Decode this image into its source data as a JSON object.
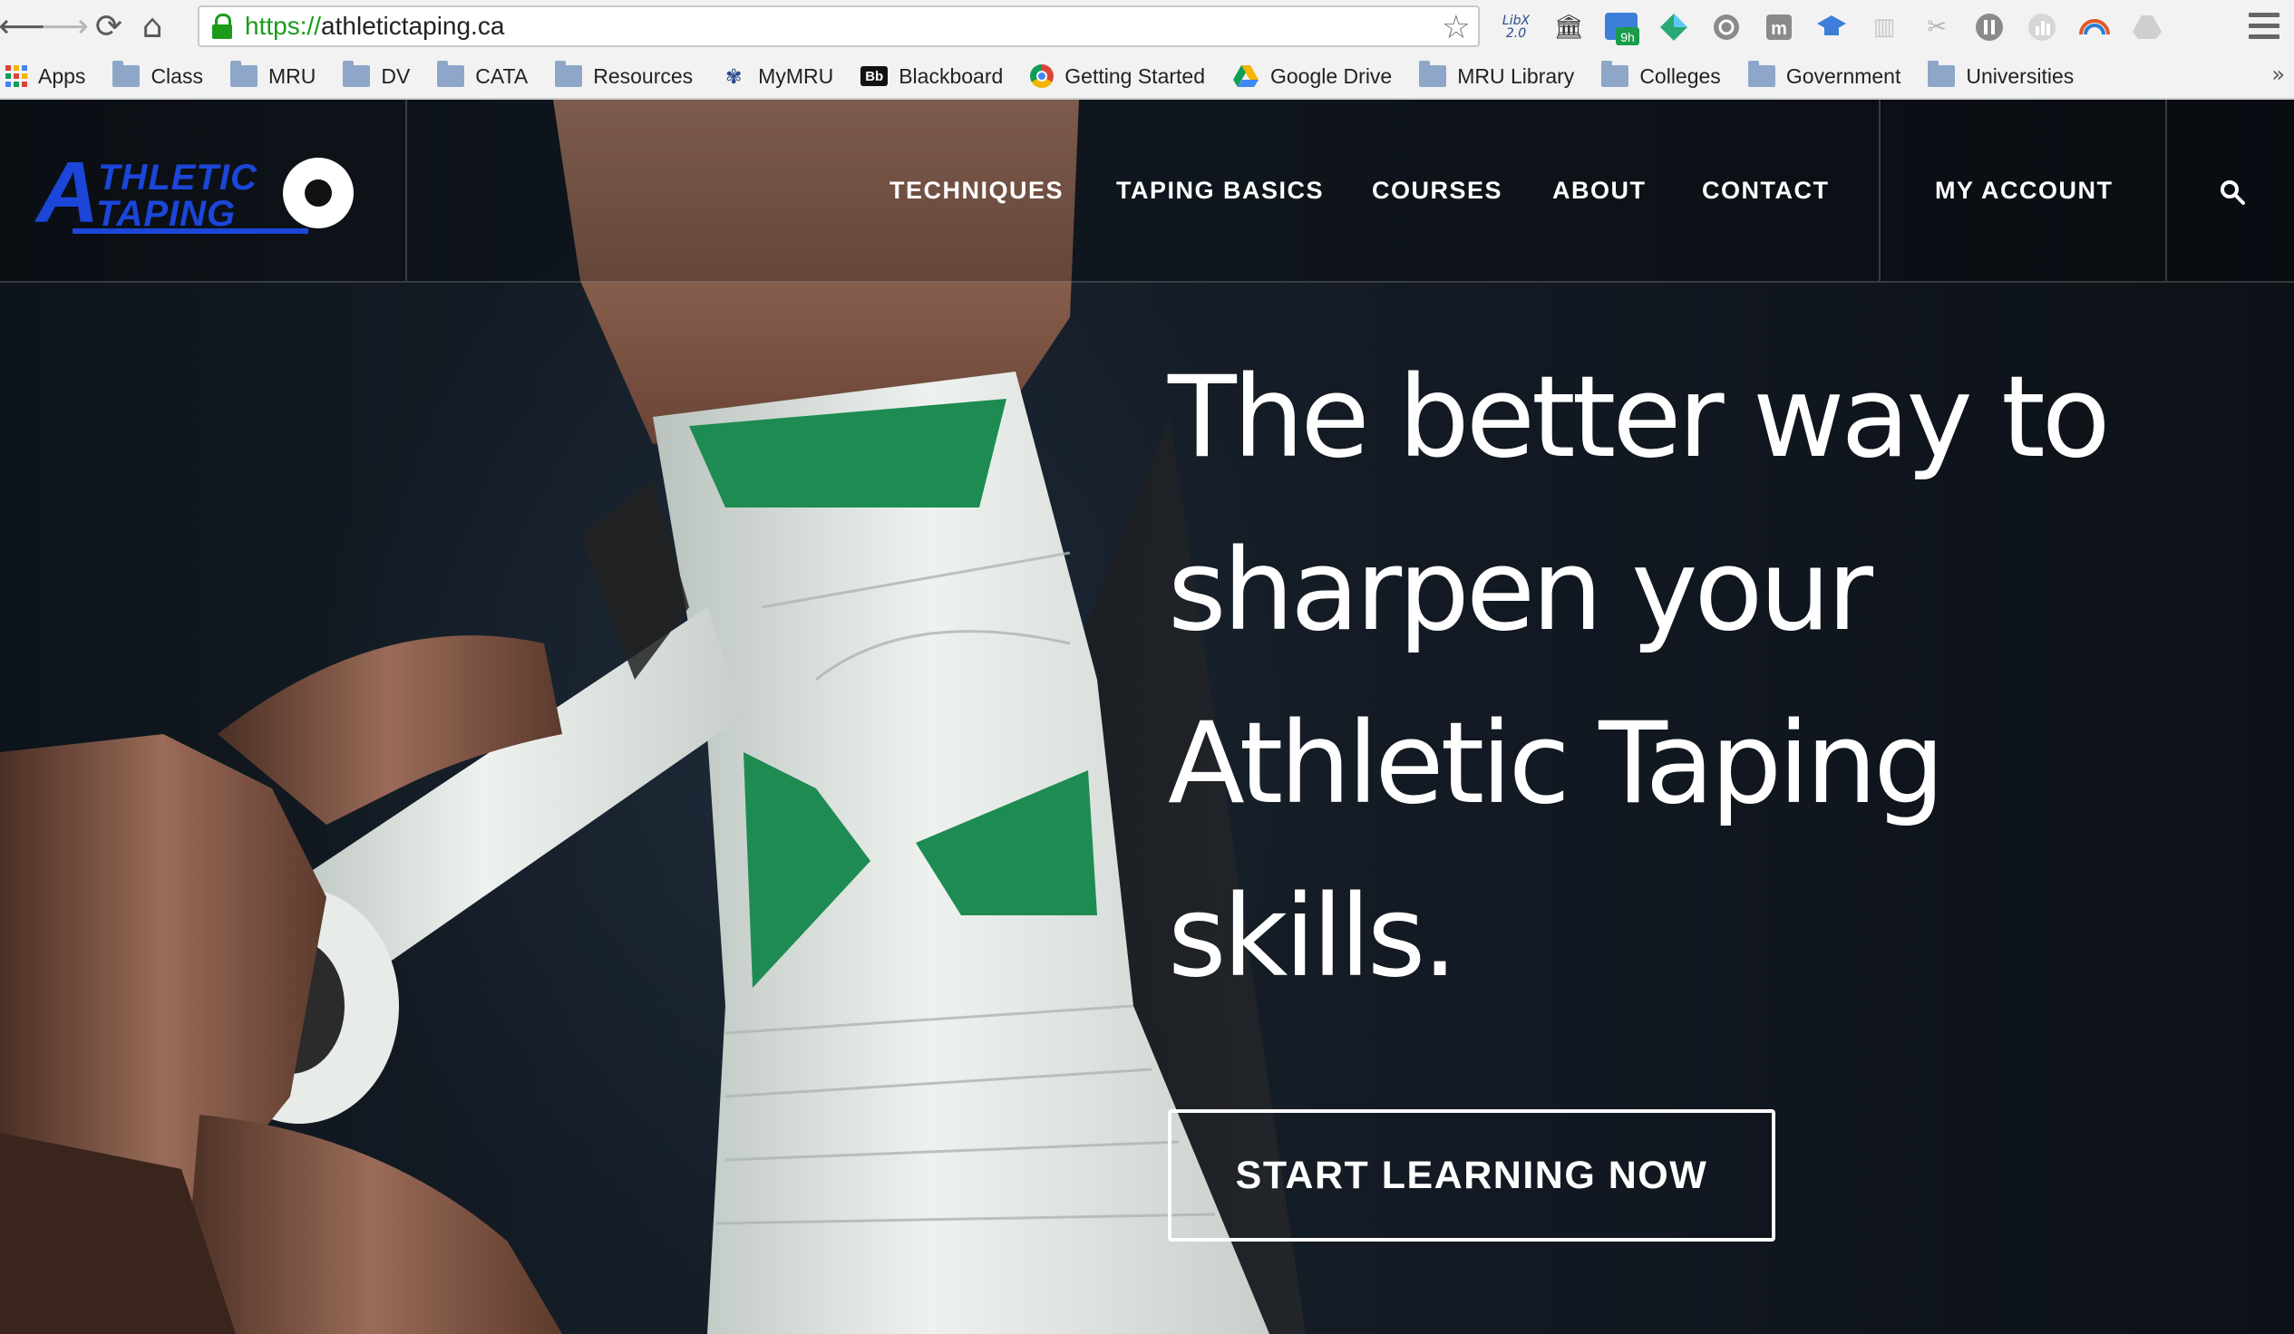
{
  "browser": {
    "url_scheme": "https://",
    "url_host": "athletictaping.ca",
    "bookmarks": [
      {
        "label": "Apps",
        "icon": "apps-grid-icon"
      },
      {
        "label": "Class",
        "icon": "folder-icon"
      },
      {
        "label": "MRU",
        "icon": "folder-icon"
      },
      {
        "label": "DV",
        "icon": "folder-icon"
      },
      {
        "label": "CATA",
        "icon": "folder-icon"
      },
      {
        "label": "Resources",
        "icon": "folder-icon"
      },
      {
        "label": "MyMRU",
        "icon": "mymru-icon"
      },
      {
        "label": "Blackboard",
        "icon": "blackboard-icon"
      },
      {
        "label": "Getting Started",
        "icon": "chrome-icon"
      },
      {
        "label": "Google Drive",
        "icon": "google-drive-icon"
      },
      {
        "label": "MRU Library",
        "icon": "folder-icon"
      },
      {
        "label": "Colleges",
        "icon": "folder-icon"
      },
      {
        "label": "Government",
        "icon": "folder-icon"
      },
      {
        "label": "Universities",
        "icon": "folder-icon"
      }
    ],
    "extension_badge": "9h",
    "libx_label": "LibX 2.0",
    "more_bookmarks": "»"
  },
  "site": {
    "logo": {
      "big_letter": "A",
      "line1": "THLETIC",
      "line2": "TAPING"
    },
    "nav": {
      "techniques": "TECHNIQUES",
      "taping_basics": "TAPING BASICS",
      "courses": "COURSES",
      "about": "ABOUT",
      "contact": "CONTACT",
      "my_account": "MY ACCOUNT"
    },
    "hero": {
      "line1": "The better way to",
      "line2": "sharpen your",
      "line3": "Athletic Taping",
      "line4": "skills.",
      "cta": "START LEARNING NOW"
    }
  },
  "colors": {
    "logo_blue": "#1b46d9",
    "tape_green": "#1e8c52",
    "secure_green": "#1a9b1a"
  }
}
